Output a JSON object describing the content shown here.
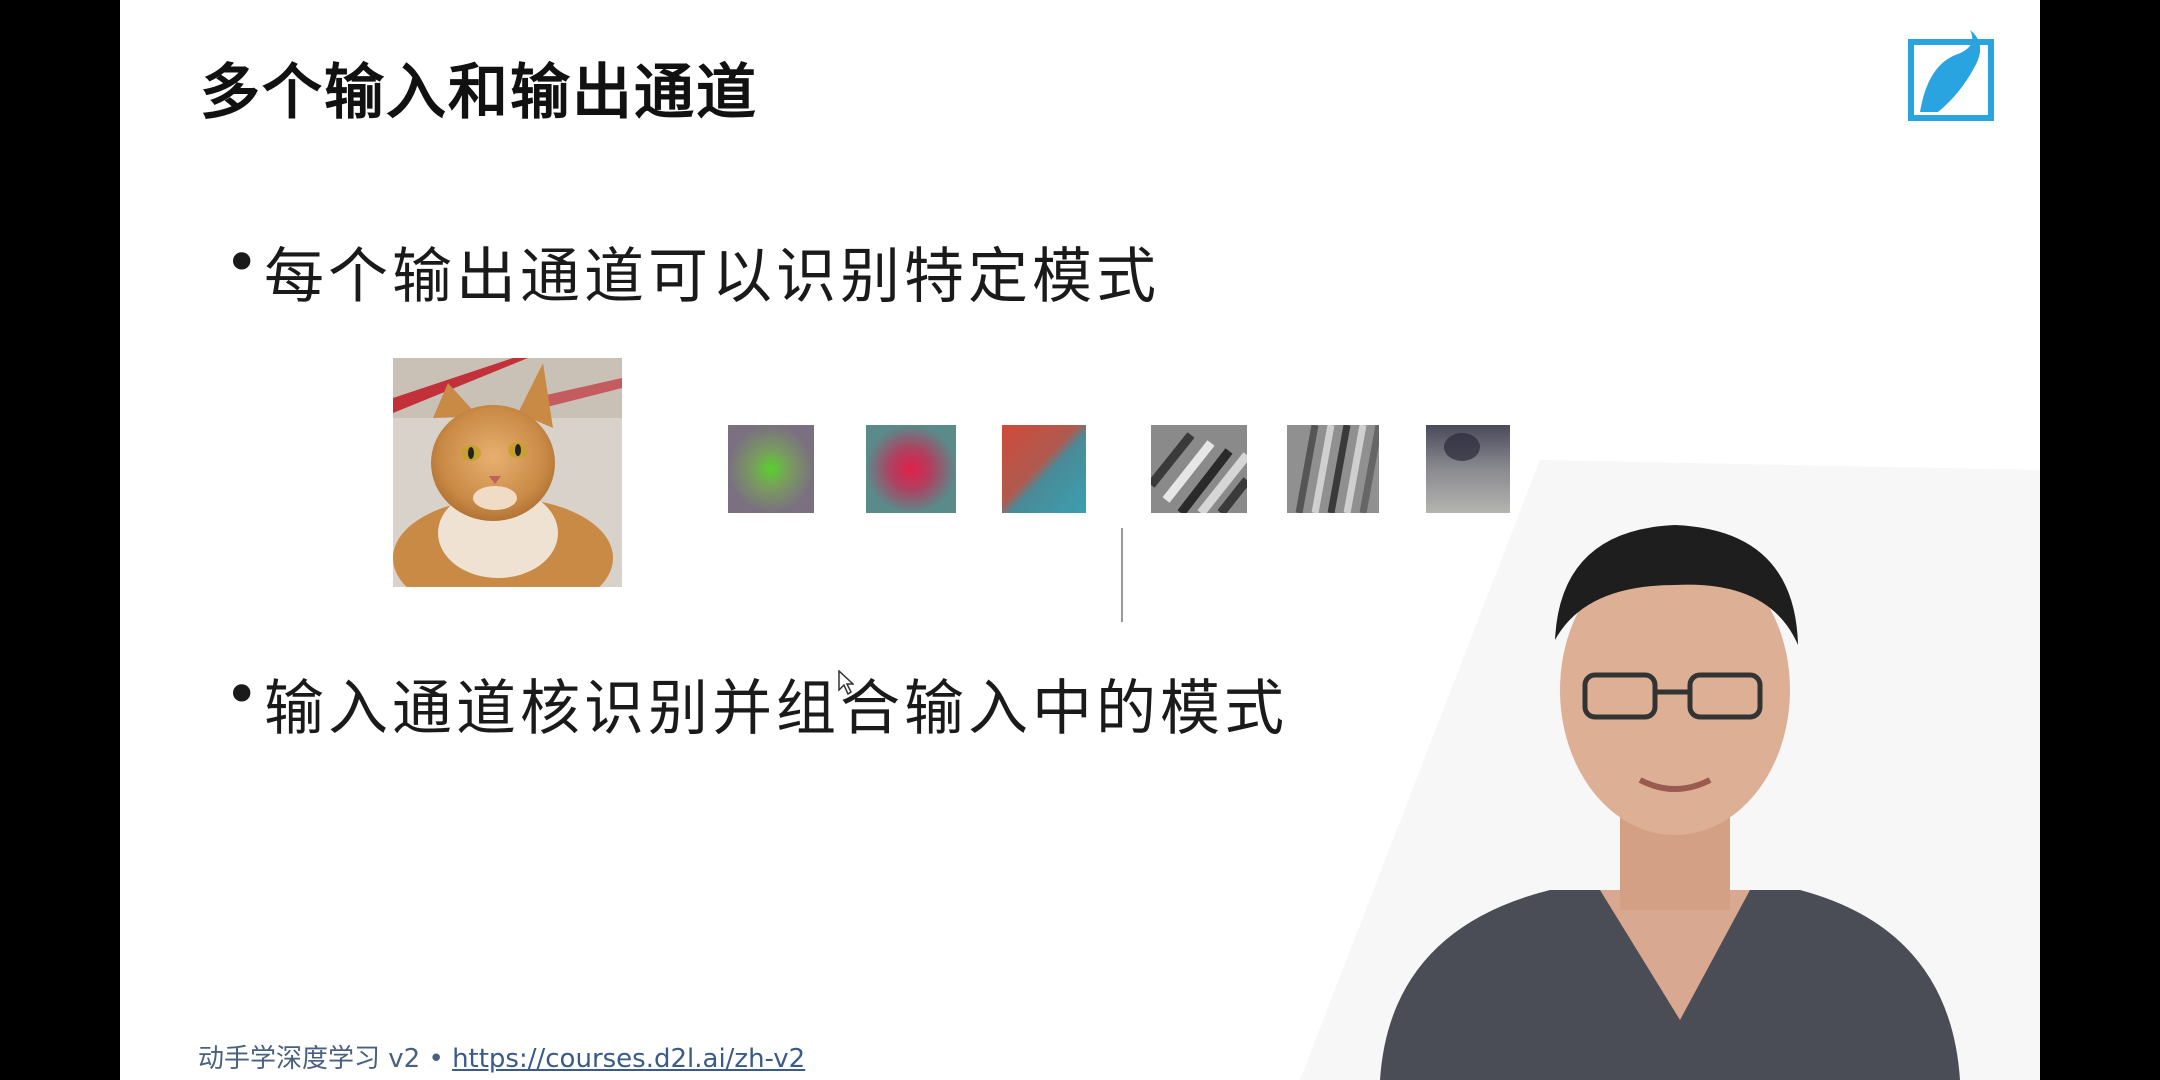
{
  "slide": {
    "title": "多个输入和输出通道",
    "bullets": [
      "每个输出通道可以识别特定模式",
      "输入通道核识别并组合输入中的模式"
    ],
    "bullet_marker": "•",
    "footer_text": "动手学深度学习 v2 • ",
    "footer_link": "https://courses.d2l.ai/zh-v2"
  },
  "icons": {
    "logo": "bilibili-logo-icon",
    "cursor": "mouse-cursor-icon"
  },
  "colors": {
    "slide_bg": "#ffffff",
    "frame_bg": "#000000",
    "title": "#111111",
    "footer": "#4a6080",
    "logo_blue": "#2aa4e0"
  }
}
